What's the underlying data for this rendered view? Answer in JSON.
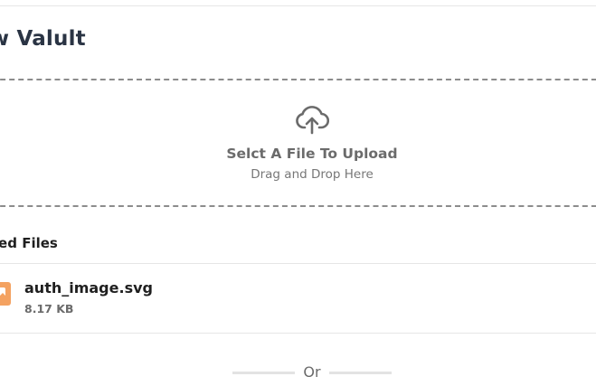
{
  "modal": {
    "title": "ew Valult"
  },
  "dropzone": {
    "icon": "cloud-upload-icon",
    "title": "Selct A File To Upload",
    "subtitle": "Drag and Drop Here"
  },
  "selected_files": {
    "heading": "cted Files",
    "files": [
      {
        "name": "auth_image.svg",
        "size": "8.17 KB",
        "icon": "image-file-icon",
        "icon_color": "#f4a261"
      }
    ]
  },
  "divider": {
    "label": "Or"
  }
}
